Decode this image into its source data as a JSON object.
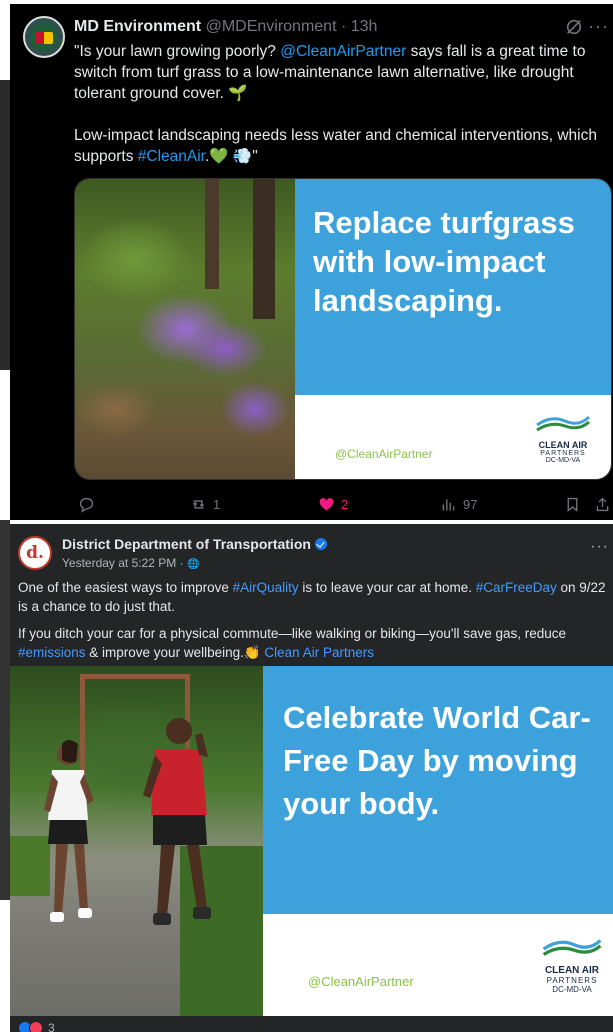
{
  "tweet": {
    "name": "MD Environment",
    "handle": "@MDEnvironment · 13h",
    "text_p1_a": "\"Is your lawn growing poorly? ",
    "mention": "@CleanAirPartner",
    "text_p1_b": " says fall is a great time to switch from turf grass to a low-maintenance lawn alternative, like drought tolerant ground cover. ",
    "sprout": "🌱",
    "text_p2_a": "Low-impact landscaping needs less water and chemical interventions, which supports ",
    "hashtag": "#CleanAir",
    "text_p2_b": ".",
    "emojis": "💚 💨",
    "text_p2_c": "\"",
    "card": {
      "headline": "Replace turfgrass with low-impact landscaping.",
      "handle": "@CleanAirPartner",
      "logo_line1": "CLEAN AIR",
      "logo_line2": "PARTNERS",
      "logo_line3": "DC-MD-VA"
    },
    "actions": {
      "reply_count": "",
      "retweet_count": "1",
      "like_count": "2",
      "views_count": "97"
    },
    "more": "···"
  },
  "facebook": {
    "page_name": "District Department of Transportation",
    "avatar_letter": "d.",
    "time": "Yesterday at 5:22 PM · ",
    "globe": "🌐",
    "more": "···",
    "p1_a": "One of the easiest ways to improve ",
    "p1_tag1": "#AirQuality",
    "p1_b": " is to leave your car at home. ",
    "p1_tag2": "#CarFreeDay",
    "p1_c": " on 9/22 is a chance to do just that.",
    "p2_a": "If you ditch your car for a physical commute—like walking or biking—you'll save gas, reduce ",
    "p2_tag": "#emissions",
    "p2_b": " & improve your wellbeing.",
    "p2_clap": "👏",
    "p2_link": " Clean Air Partners",
    "image": {
      "headline": "Celebrate World Car-Free Day by moving your body.",
      "handle": "@CleanAirPartner",
      "logo_line1": "CLEAN AIR",
      "logo_line2": "PARTNERS",
      "logo_line3": "DC-MD-VA"
    },
    "reaction_count": "3"
  },
  "colors": {
    "twitter_bg": "#000000",
    "facebook_bg": "#242526",
    "link_blue": "#1d9bf0",
    "card_blue": "#3da2dc",
    "like_pink": "#f91880"
  }
}
